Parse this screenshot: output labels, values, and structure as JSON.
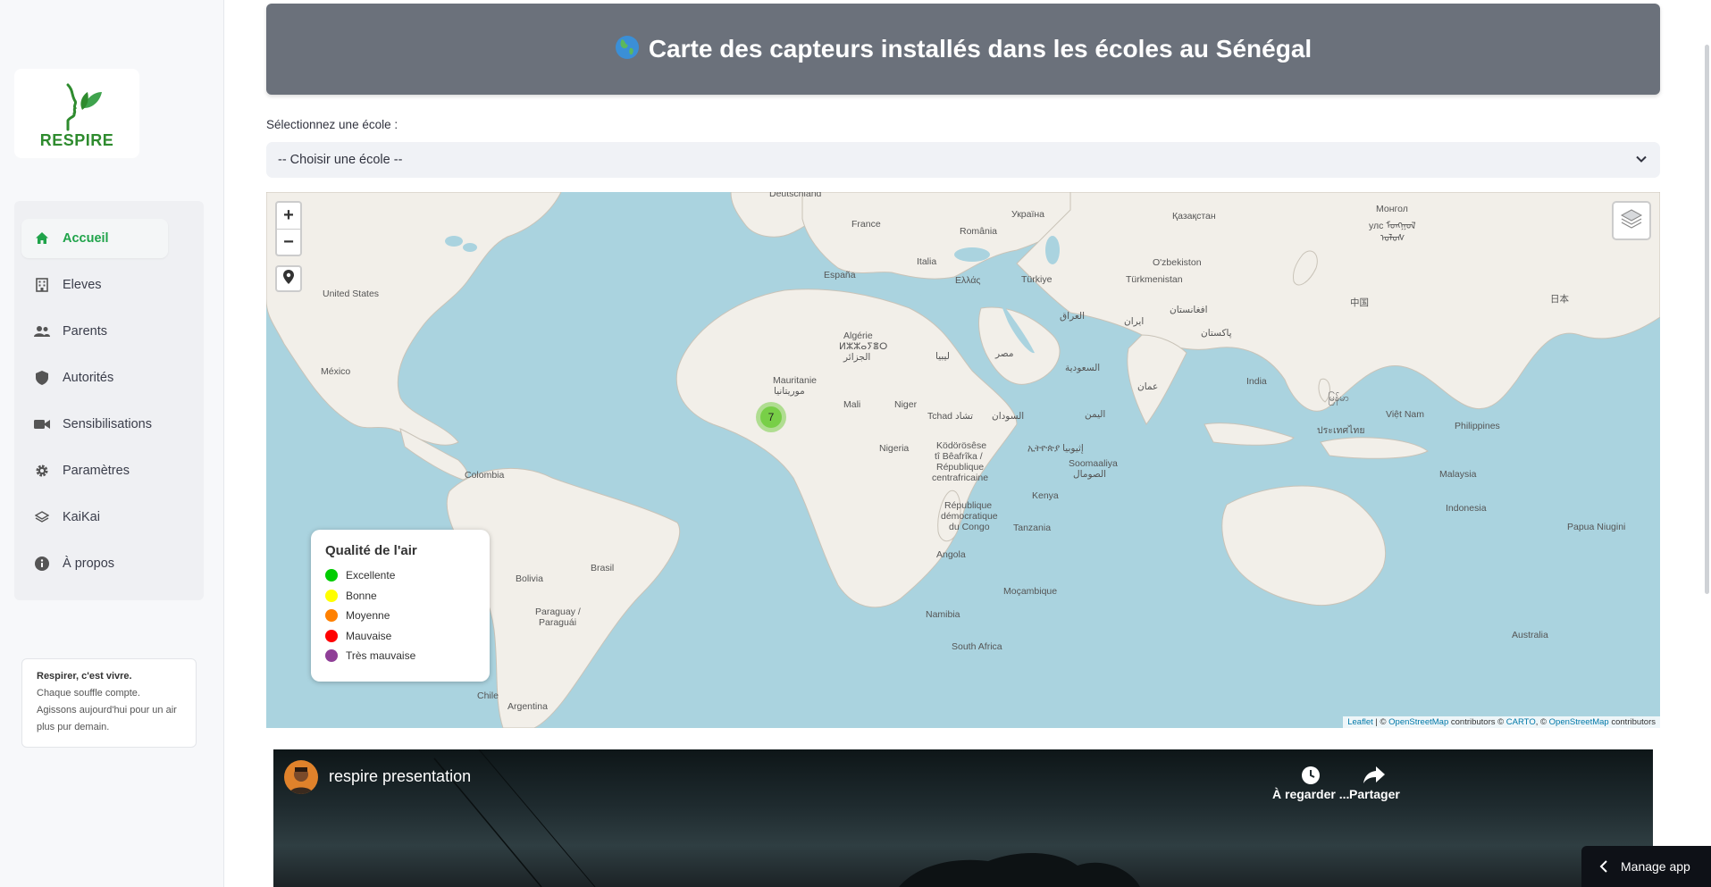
{
  "sidebar": {
    "logo_text": "RESPIRE",
    "items": [
      {
        "label": "Accueil",
        "icon": "home-icon",
        "active": true
      },
      {
        "label": "Eleves",
        "icon": "building-icon",
        "active": false
      },
      {
        "label": "Parents",
        "icon": "people-icon",
        "active": false
      },
      {
        "label": "Autorités",
        "icon": "shield-icon",
        "active": false
      },
      {
        "label": "Sensibilisations",
        "icon": "video-camera-icon",
        "active": false
      },
      {
        "label": "Paramètres",
        "icon": "gear-icon",
        "active": false
      },
      {
        "label": "KaiKai",
        "icon": "layers-icon",
        "active": false
      },
      {
        "label": "À propos",
        "icon": "info-icon",
        "active": false
      }
    ],
    "quote": {
      "title": "Respirer, c'est vivre.",
      "line1": "Chaque souffle compte.",
      "line2": "Agissons aujourd'hui pour un air",
      "line3": "plus pur demain."
    }
  },
  "header": {
    "icon": "globe-icon",
    "title": "Carte des capteurs installés dans les écoles au Sénégal"
  },
  "school_select": {
    "label": "Sélectionnez une école :",
    "value": "-- Choisir une école --"
  },
  "map": {
    "zoom_in": "+",
    "zoom_out": "−",
    "cluster_count": "7",
    "labels": {
      "deutschland": "Deutschland",
      "ukraine": "Україна",
      "kazakhstan": "Қазақстан",
      "mongolia1": "Монгол",
      "mongolia2": "улс ᠮᠤᠩᠭᠤᠯ",
      "mongolia3": "ᠤᠯᠤᠰ",
      "france": "France",
      "romania": "România",
      "uzbek": "O'zbekiston",
      "espana": "España",
      "italia": "Italia",
      "ellas": "Ελλάς",
      "turkiye": "Türkiye",
      "turkmen": "Türkmenistan",
      "china": "中国",
      "japan": "日本",
      "usa": "United States",
      "iraq": "العراق",
      "iran": "ایران",
      "afghan": "افغانستان",
      "pakistan": "پاکستان",
      "algerie1": "Algérie",
      "algerie2": "ⵍⵣⵣⴰⵢⴻⵔ",
      "algerie3": "الجزائر",
      "libya": "ليبيا",
      "egypt": "مصر",
      "saudi": "السعودية",
      "mexico": "México",
      "oman": "عمان",
      "india": "India",
      "mauritanie1": "Mauritanie",
      "mauritanie2": "موريتانيا",
      "mali": "Mali",
      "niger": "Niger",
      "tchad": "Tchad تشاد",
      "sudan": "السودان",
      "yemen": "اليمن",
      "myanmar": "မြန်မာ",
      "vietnam": "Việt Nam",
      "thailand": "ประเทศไทย",
      "philippines": "Philippines",
      "nigeria": "Nigeria",
      "rca1": "Ködörösêse",
      "rca2": "tî Bêafrîka /",
      "rca3": "République",
      "rca4": "centrafricaine",
      "ethiopia": "ኢትዮጵያ إثيوبيا",
      "somalia1": "Soomaaliya",
      "somalia2": "الصومال",
      "colombia": "Colombia",
      "malaysia": "Malaysia",
      "kenya": "Kenya",
      "rdc1": "République",
      "rdc2": "démocratique",
      "rdc3": "du Congo",
      "tanzania": "Tanzania",
      "indonesia": "Indonesia",
      "png": "Papua Niugini",
      "brasil": "Brasil",
      "bolivia": "Bolivia",
      "angola": "Angola",
      "mocambique": "Moçambique",
      "paraguay1": "Paraguay /",
      "paraguay2": "Paraguái",
      "namibia": "Namibia",
      "australia": "Australia",
      "southafrica": "South Africa",
      "chile": "Chile",
      "argentina": "Argentina"
    },
    "legend": {
      "title": "Qualité de l'air",
      "items": [
        {
          "label": "Excellente",
          "color": "#00cc00"
        },
        {
          "label": "Bonne",
          "color": "#ffff00"
        },
        {
          "label": "Moyenne",
          "color": "#ff8000"
        },
        {
          "label": "Mauvaise",
          "color": "#ff0000"
        },
        {
          "label": "Très mauvaise",
          "color": "#8f3f97"
        }
      ]
    },
    "attribution": {
      "leaflet": "Leaflet",
      "sep1": " | © ",
      "osm1": "OpenStreetMap",
      "mid": " contributors © ",
      "carto": "CARTO",
      "sep2": ", © ",
      "osm2": "OpenStreetMap",
      "end": " contributors"
    }
  },
  "video": {
    "title": "respire presentation",
    "watch_later": "À regarder ...",
    "share": "Partager"
  },
  "manage_app": "Manage app"
}
